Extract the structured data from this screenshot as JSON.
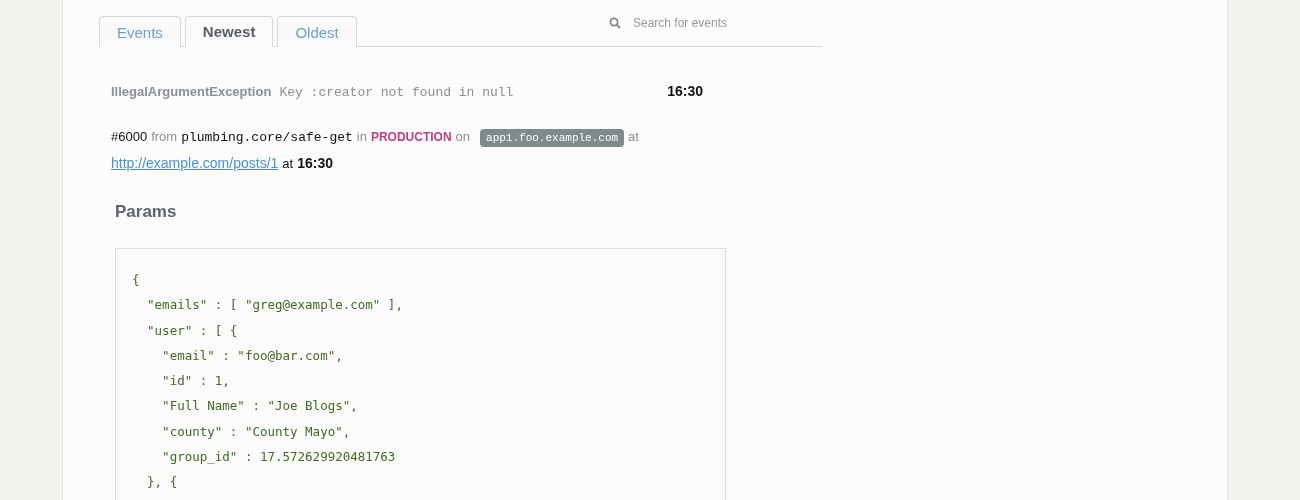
{
  "tabs": [
    {
      "label": "Events",
      "selected": false
    },
    {
      "label": "Newest",
      "selected": true
    },
    {
      "label": "Oldest",
      "selected": false
    }
  ],
  "search": {
    "placeholder": "Search for events"
  },
  "event": {
    "exception": "IllegalArgumentException",
    "message": "Key :creator not found in null",
    "time": "16:30"
  },
  "detail": {
    "number": "#6000",
    "from_word": "from",
    "source": "plumbing.core/safe-get",
    "in_word": "in",
    "environment": "PRODUCTION",
    "on_word": "on",
    "host": "app1.foo.example.com",
    "at_word": "at",
    "url": "http://example.com/posts/1",
    "at_word_2": "at",
    "time": "16:30"
  },
  "params": {
    "title": "Params",
    "lines": [
      "{",
      "  \"emails\" : [ \"greg@example.com\" ],",
      "  \"user\" : [ {",
      "    \"email\" : \"foo@bar.com\",",
      "    \"id\" : 1,",
      "    \"Full Name\" : \"Joe Blogs\",",
      "    \"county\" : \"County Mayo\",",
      "    \"group_id\" : 17.572629920481763",
      "  }, {"
    ]
  }
}
